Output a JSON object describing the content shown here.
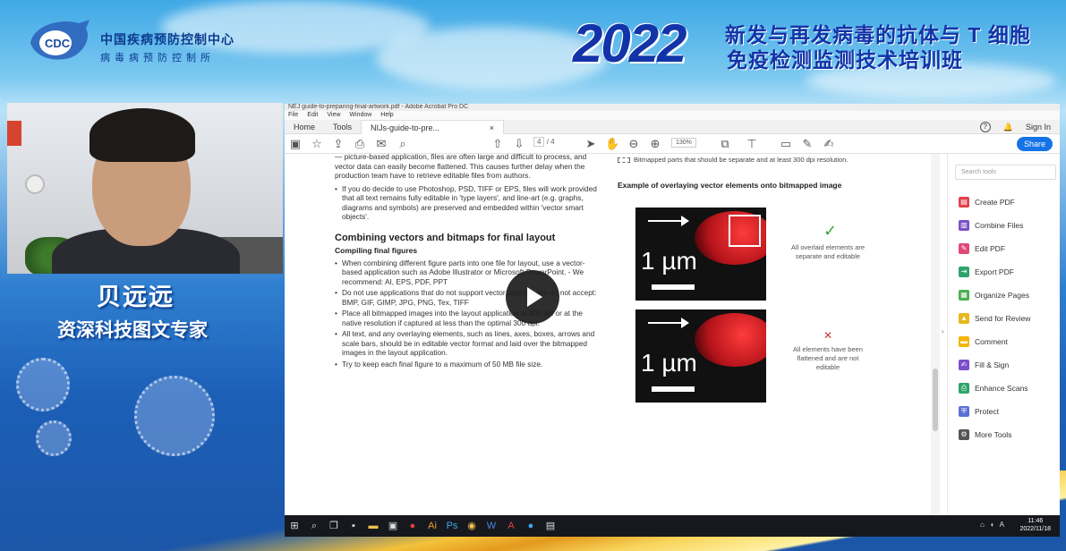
{
  "header": {
    "org_cn": "中国疾病预防控制中心",
    "org_cn_sub": "病毒病预防控制所",
    "logo_text": "CDC",
    "year": "2022",
    "title_line1": "新发与再发病毒的抗体与 T 细胞",
    "title_line2": "免疫检测监测技术培训班"
  },
  "speaker": {
    "name": "贝远远",
    "role": "资深科技图文专家"
  },
  "app": {
    "title": "NEJ guide-to-preparing-final-artwork.pdf - Adobe Acrobat Pro DC",
    "menu": [
      "File",
      "Edit",
      "View",
      "Window",
      "Help"
    ],
    "tabs": {
      "home": "Home",
      "tools": "Tools",
      "doc": "NIJs-guide-to-pre...",
      "close": "×"
    },
    "signin": "Sign In",
    "help": "?",
    "bell": "🔔",
    "page_current": "4",
    "page_total": "/ 4",
    "zoom": "130%",
    "share": "Share"
  },
  "document": {
    "para_top": "— picture-based application, files are often large and difficult to process, and vector data can easily become flattened. This causes further delay when the production team have to retrieve editable files from authors.",
    "bullet_top": "If you do decide to use Photoshop, PSD, TIFF or EPS, files will work provided that all text remains fully editable in 'type layers', and line-art (e.g. graphs, diagrams and symbols) are preserved and embedded within 'vector smart objects'.",
    "heading": "Combining vectors and bitmaps for final layout",
    "subheading": "Compiling final figures",
    "bullets": [
      "When combining different figure parts into one file for layout, use a vector-based application such as Adobe Illustrator or Microsoft PowerPoint. - We recommend: AI, EPS, PDF, PPT",
      "Do not use applications that do not support vector output. - We do not accept: BMP, GIF, GIMP, JPG, PNG, Tex, TIFF",
      "Place all bitmapped images into the layout application at 300 dpi or at the native resolution if captured at less than the optimal 300 dpi.",
      "All text, and any overlaying elements, such as lines, axes, boxes, arrows and scale bars, should be in editable vector format and laid over the bitmapped images in the layout application.",
      "Try to keep each final figure to a maximum of 50 MB file size."
    ],
    "legend_caption": "Bitmapped parts that should be separate and at least 300 dpi resolution.",
    "example_heading": "Example of overlaying vector elements onto bitmapped image",
    "scale_text": "1 µm",
    "note_good": "All overlaid elements are separate and editable",
    "note_bad": "All elements have been flattened and are not editable",
    "check": "✓",
    "cross": "✕"
  },
  "sidebar": {
    "search_placeholder": "Search tools",
    "items": [
      {
        "label": "Create PDF",
        "color": "#e0424a",
        "icon": "create-pdf-icon"
      },
      {
        "label": "Combine Files",
        "color": "#7a4fc9",
        "icon": "combine-files-icon"
      },
      {
        "label": "Edit PDF",
        "color": "#e04878",
        "icon": "edit-pdf-icon"
      },
      {
        "label": "Export PDF",
        "color": "#2fa36b",
        "icon": "export-pdf-icon"
      },
      {
        "label": "Organize Pages",
        "color": "#4caf50",
        "icon": "organize-pages-icon"
      },
      {
        "label": "Send for Review",
        "color": "#e8b91e",
        "icon": "send-review-icon"
      },
      {
        "label": "Comment",
        "color": "#f4b400",
        "icon": "comment-icon"
      },
      {
        "label": "Fill & Sign",
        "color": "#7a4fc9",
        "icon": "fill-sign-icon"
      },
      {
        "label": "Enhance Scans",
        "color": "#2fa36b",
        "icon": "enhance-scans-icon"
      },
      {
        "label": "Protect",
        "color": "#5a6fd6",
        "icon": "protect-icon"
      },
      {
        "label": "More Tools",
        "color": "#555555",
        "icon": "more-tools-icon"
      }
    ]
  },
  "taskbar": {
    "time": "11:46",
    "date": "2022/11/18"
  }
}
